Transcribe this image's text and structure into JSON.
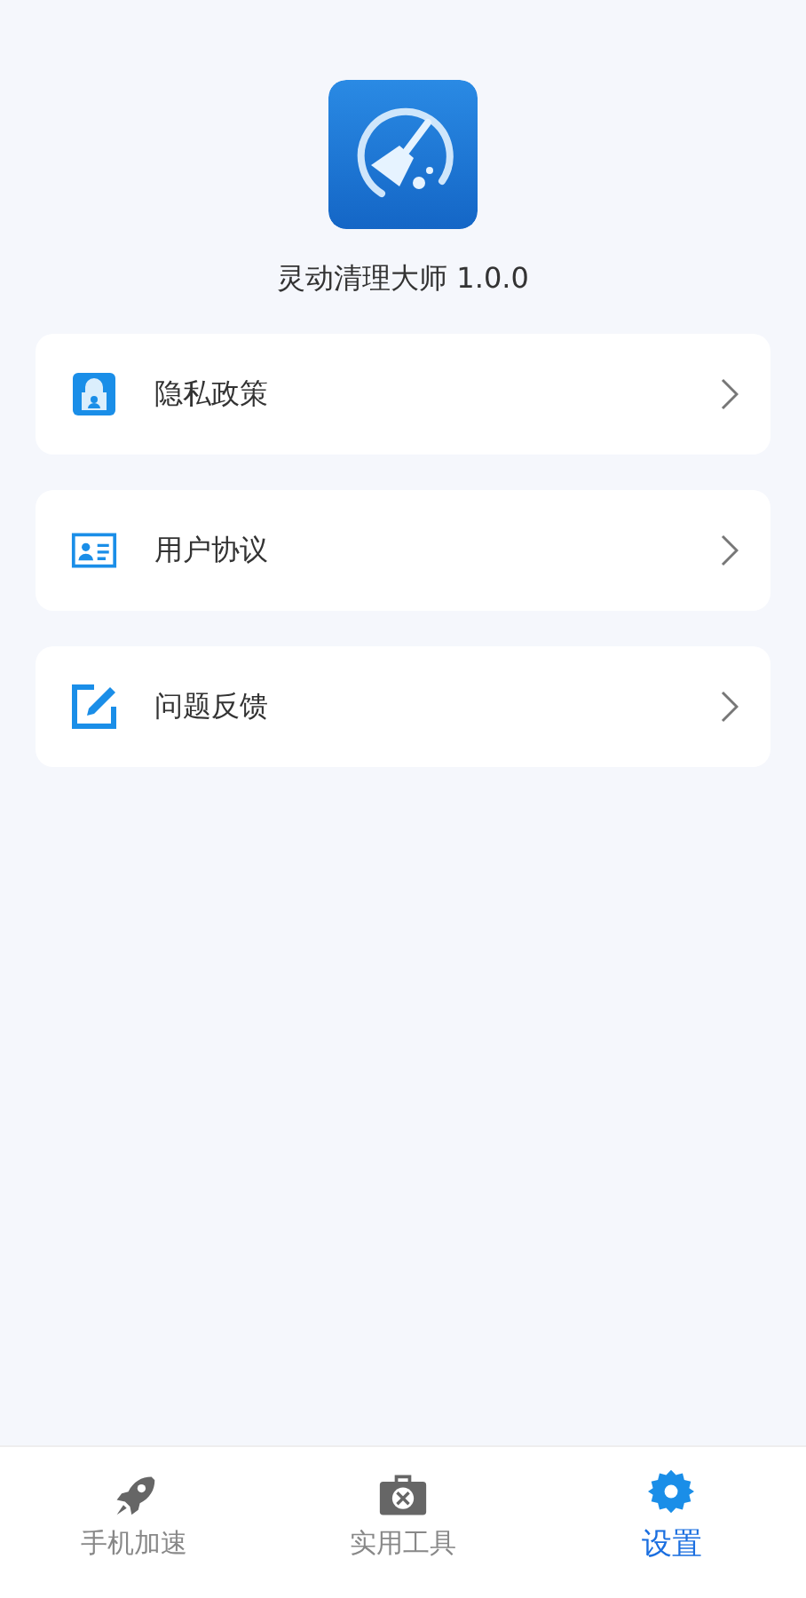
{
  "app": {
    "title": "灵动清理大师 1.0.0"
  },
  "menu": [
    {
      "kind": "privacy",
      "label": "隐私政策"
    },
    {
      "kind": "agreement",
      "label": "用户协议"
    },
    {
      "kind": "feedback",
      "label": "问题反馈"
    }
  ],
  "tabs": [
    {
      "kind": "boost",
      "label": "手机加速",
      "selected": false
    },
    {
      "kind": "tools",
      "label": "实用工具",
      "selected": false
    },
    {
      "kind": "settings",
      "label": "设置",
      "selected": true
    }
  ]
}
